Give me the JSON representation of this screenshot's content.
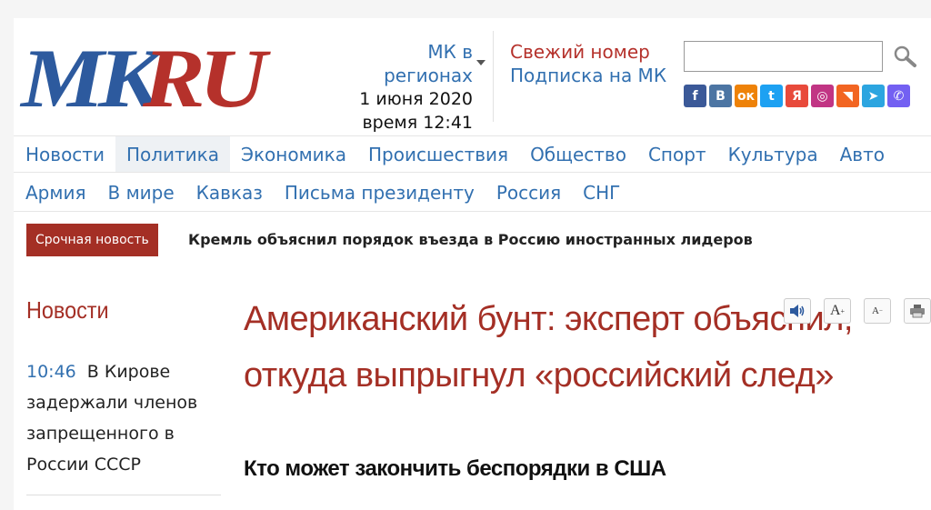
{
  "header": {
    "logo_mk": "MK",
    "logo_ru": "RU",
    "region_line1": "МК в",
    "region_line2": "регионах",
    "date": "1 июня 2020",
    "time": "время 12:41",
    "fresh_issue": "Свежий номер",
    "subscription": "Подписка на МК",
    "search_placeholder": "",
    "socials": [
      {
        "name": "facebook-icon",
        "glyph": "f",
        "color": "#3b5998"
      },
      {
        "name": "vkontakte-icon",
        "glyph": "B",
        "color": "#4c75a3"
      },
      {
        "name": "odnoklassniki-icon",
        "glyph": "ок",
        "color": "#ee8208"
      },
      {
        "name": "twitter-icon",
        "glyph": "t",
        "color": "#1da1f2"
      },
      {
        "name": "yandex-icon",
        "glyph": "Я",
        "color": "#e84a3b"
      },
      {
        "name": "instagram-icon",
        "glyph": "◎",
        "color": "#c13584"
      },
      {
        "name": "rss-icon",
        "glyph": "◥",
        "color": "#f26522"
      },
      {
        "name": "telegram-icon",
        "glyph": "➤",
        "color": "#2ca5e0"
      },
      {
        "name": "viber-icon",
        "glyph": "✆",
        "color": "#7360f2"
      }
    ]
  },
  "nav_primary": [
    "Новости",
    "Политика",
    "Экономика",
    "Происшествия",
    "Общество",
    "Спорт",
    "Культура",
    "Авто"
  ],
  "nav_primary_active": "Политика",
  "nav_secondary": [
    "Армия",
    "В мире",
    "Кавказ",
    "Письма президенту",
    "Россия",
    "СНГ"
  ],
  "breaking": {
    "badge": "Срочная новость",
    "text": "Кремль объяснил порядок въезда в Россию иностранных лидеров"
  },
  "sidebar": {
    "heading": "Новости",
    "items": [
      {
        "time": "10:46",
        "text": "В Кирове задержали членов запрещенного в России СССР"
      }
    ]
  },
  "article": {
    "title": "Американский бунт: эксперт объяснил, откуда выпрыгнул «российский след»",
    "subtitle": "Кто может закончить беспорядки в США",
    "tools": {
      "font_larger": "A",
      "font_smaller": "A"
    }
  },
  "colors": {
    "brand_red": "#a42f25",
    "link_blue": "#3270b0",
    "logo_blue": "#2d5a9e"
  }
}
